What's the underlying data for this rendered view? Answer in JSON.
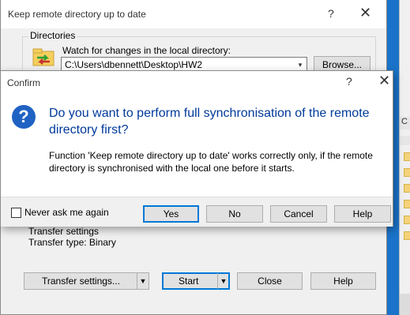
{
  "background_window": {
    "tag": "C",
    "folder_count": 6
  },
  "main_window": {
    "title": "Keep remote directory up to date",
    "help_glyph": "?",
    "close_glyph": "✕",
    "directories_label": "Directories",
    "watch_label": "Watch for changes in the local directory:",
    "local_directory": "C:\\Users\\dbennett\\Desktop\\HW2",
    "browse_label": "Browse...",
    "transfer_settings_heading": "Transfer settings",
    "transfer_type": "Transfer type: Binary",
    "buttons": {
      "transfer_settings": "Transfer settings...",
      "start": "Start",
      "close": "Close",
      "help": "Help"
    },
    "dropdown_glyph": "▾",
    "split_arrow_glyph": "▼"
  },
  "confirm_dialog": {
    "title": "Confirm",
    "help_glyph": "?",
    "close_glyph": "✕",
    "icon_glyph": "?",
    "heading": "Do you want to perform full synchronisation of the remote directory first?",
    "message": "Function 'Keep remote directory up to date' works correctly only, if the remote directory is synchronised with the local one before it starts.",
    "checkbox_label": "Never ask me again",
    "checkbox_checked": false,
    "buttons": {
      "yes": "Yes",
      "no": "No",
      "cancel": "Cancel",
      "help": "Help"
    }
  },
  "colors": {
    "desktop": "#1a73c9",
    "heading_blue": "#003a9b",
    "question_icon": "#1f62c3",
    "default_button_border": "#0078d7"
  }
}
